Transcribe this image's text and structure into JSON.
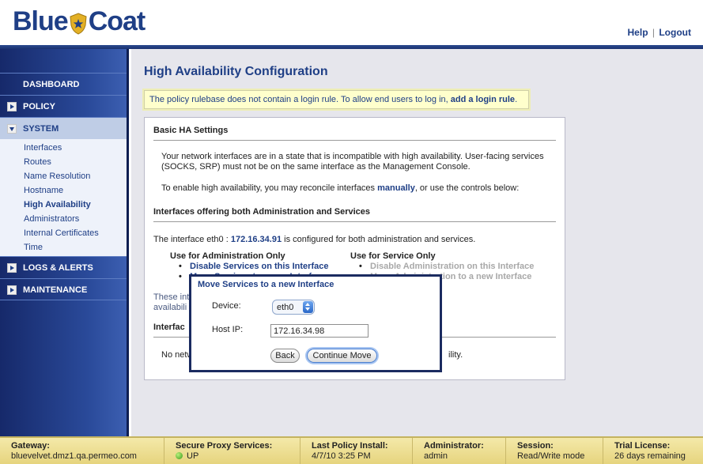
{
  "brand": {
    "logo_text_left": "Blue",
    "logo_text_right": "Coat"
  },
  "header": {
    "help": "Help",
    "separator": "|",
    "logout": "Logout"
  },
  "sidebar": {
    "dashboard": "DASHBOARD",
    "policy": "POLICY",
    "system": "SYSTEM",
    "system_items": [
      "Interfaces",
      "Routes",
      "Name Resolution",
      "Hostname",
      "High Availability",
      "Administrators",
      "Internal Certificates",
      "Time"
    ],
    "logs": "LOGS & ALERTS",
    "maintenance": "MAINTENANCE"
  },
  "main": {
    "title": "High Availability Configuration",
    "notice_text": "The policy rulebase does not contain a login rule. To allow end users to log in,",
    "notice_link": "add a login rule",
    "notice_end": ".",
    "basic_head": "Basic HA Settings",
    "para1": "Your network interfaces are in a state that is incompatible with high availability. User-facing services (SOCKS, SRP) must not be on the same interface as the Management Console.",
    "para2_start": "To enable high availability, you may reconcile interfaces",
    "para2_link": "manually",
    "para2_end": ", or use the controls below:",
    "iface_head": "Interfaces offering both Administration and Services",
    "iface_line_start": "The interface eth0 :",
    "iface_ip": "172.16.34.91",
    "iface_line_end": "is configured for both administration and services.",
    "admin_only": "Use for Administration Only",
    "service_only": "Use for Service Only",
    "disable_services": "Disable Services on this Interface",
    "move_admin": "Move Services to a new Interface",
    "disable_admin": "Disable Administration on this Interface",
    "move_services": "Move Administration to a new Interface",
    "these_partial_1": "These inte",
    "these_partial_2": "availabili",
    "interfaces_partial": "Interfac",
    "no_net_partial": "No netw",
    "ility_partial": "ility."
  },
  "dialog": {
    "title": "Move Services to a new Interface",
    "device_label": "Device:",
    "device_value": "eth0",
    "host_label": "Host IP:",
    "host_value": "172.16.34.98",
    "back": "Back",
    "continue": "Continue Move"
  },
  "status": {
    "gateway_k": "Gateway:",
    "gateway_v": "bluevelvet.dmz1.qa.permeo.com",
    "proxy_k": "Secure Proxy Services:",
    "proxy_v": "UP",
    "policy_k": "Last Policy Install:",
    "policy_v": "4/7/10 3:25 PM",
    "admin_k": "Administrator:",
    "admin_v": "admin",
    "session_k": "Session:",
    "session_v": "Read/Write mode",
    "trial_k": "Trial License:",
    "trial_v": "26 days remaining"
  },
  "colors": {
    "brand_blue": "#1f3f86",
    "notice_bg": "#ffffcc",
    "status_bg": "#f0e29a",
    "status_up": "#3a9a18"
  }
}
